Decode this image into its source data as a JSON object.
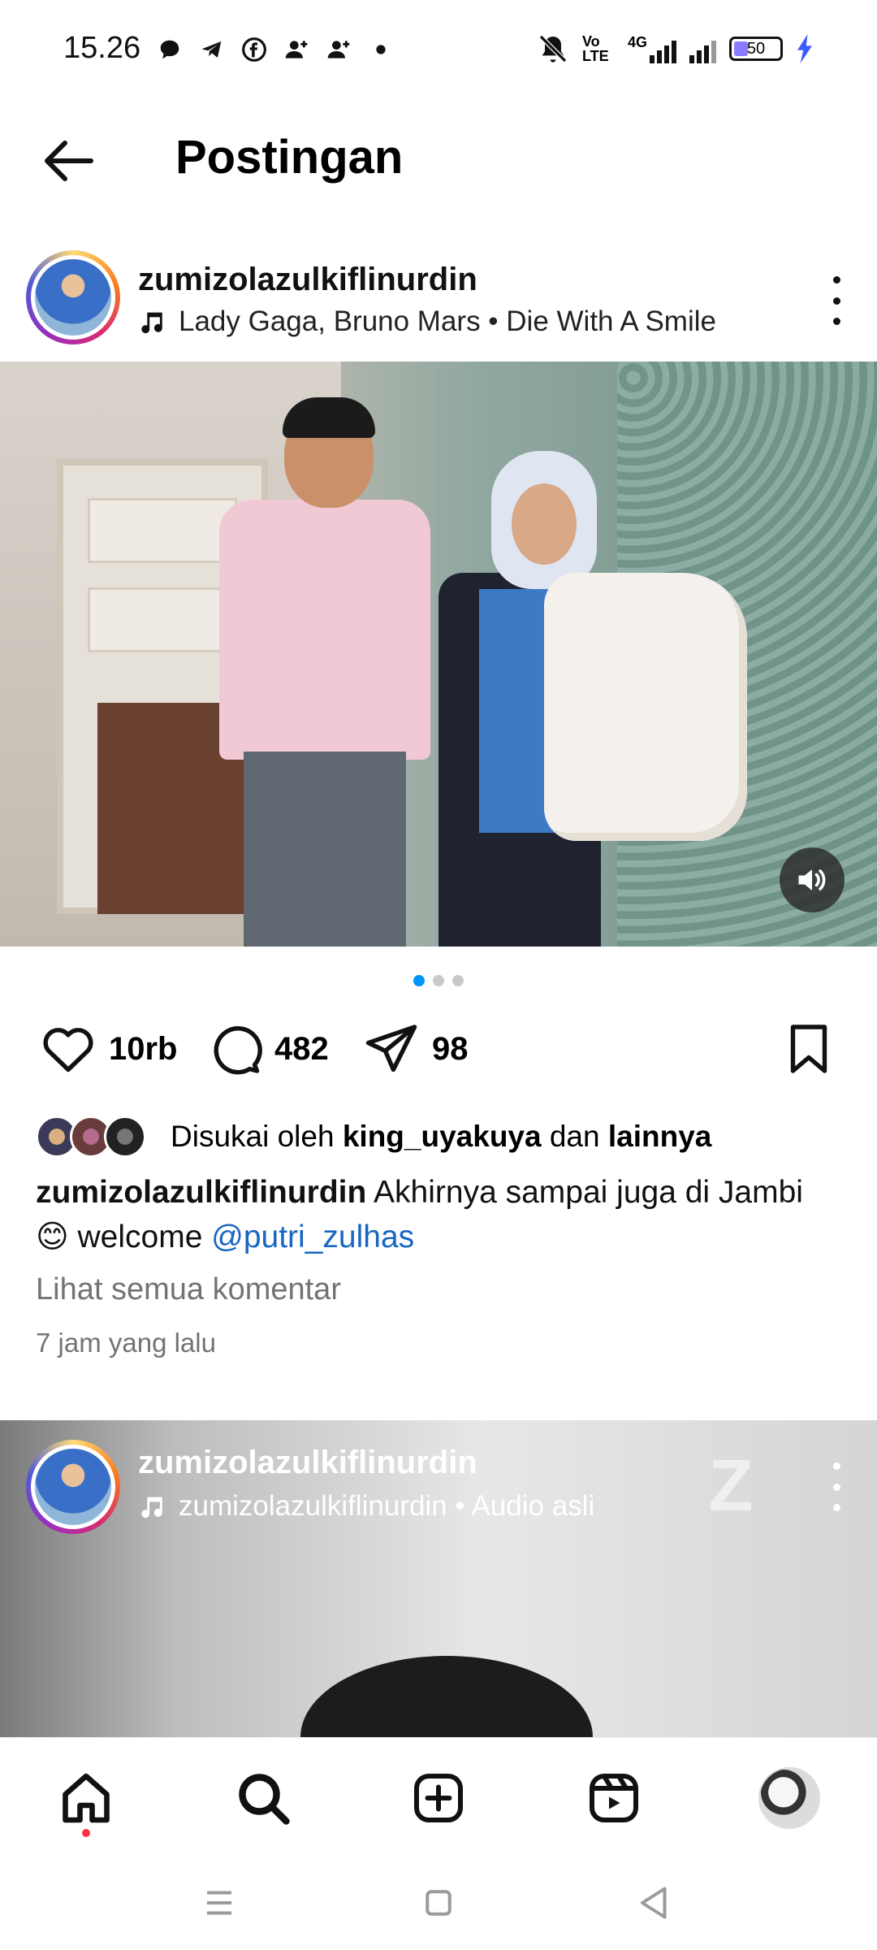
{
  "status_bar": {
    "time": "15.26",
    "left_icons": [
      "chat-bubble-icon",
      "telegram-icon",
      "facebook-icon",
      "person-add-icon",
      "person-add-icon",
      "dot-icon"
    ],
    "right_icons": [
      "mute-icon",
      "volte-icon",
      "4g-signal-icon",
      "signal-icon"
    ],
    "volte_label": "Vo LTE",
    "network_label": "4G",
    "battery_level": "50",
    "battery_color": "#8a7cff",
    "charging_color": "#3b5bff"
  },
  "header": {
    "title": "Postingan"
  },
  "post1": {
    "username": "zumizolazulkiflinurdin",
    "music": "Lady Gaga, Bruno Mars • Die With A Smile",
    "carousel_total": 3,
    "carousel_active": 1,
    "likes_count": "10rb",
    "comments_count": "482",
    "shares_count": "98",
    "liked_by_prefix": "Disukai oleh",
    "liked_by_user": "king_uyakuya",
    "liked_by_and": "dan",
    "liked_by_others": "lainnya",
    "caption_user": "zumizolazulkiflinurdin",
    "caption_text": "Akhirnya sampai juga di Jambi",
    "caption_emoji": "😊",
    "caption_welcome": "welcome",
    "caption_mention": "@putri_zulhas",
    "view_comments": "Lihat semua komentar",
    "time_ago": "7 jam yang lalu"
  },
  "post2": {
    "username": "zumizolazulkiflinurdin",
    "music": "zumizolazulkiflinurdin • Audio asli",
    "watermark": "Z"
  },
  "bottom_nav": {
    "items": [
      "home-icon",
      "search-icon",
      "create-icon",
      "reels-icon",
      "profile-avatar"
    ],
    "notification_dot_color": "#ff3040"
  },
  "colors": {
    "accent": "#0095f6",
    "mention": "#1766c1",
    "secondary_text": "#737373"
  }
}
